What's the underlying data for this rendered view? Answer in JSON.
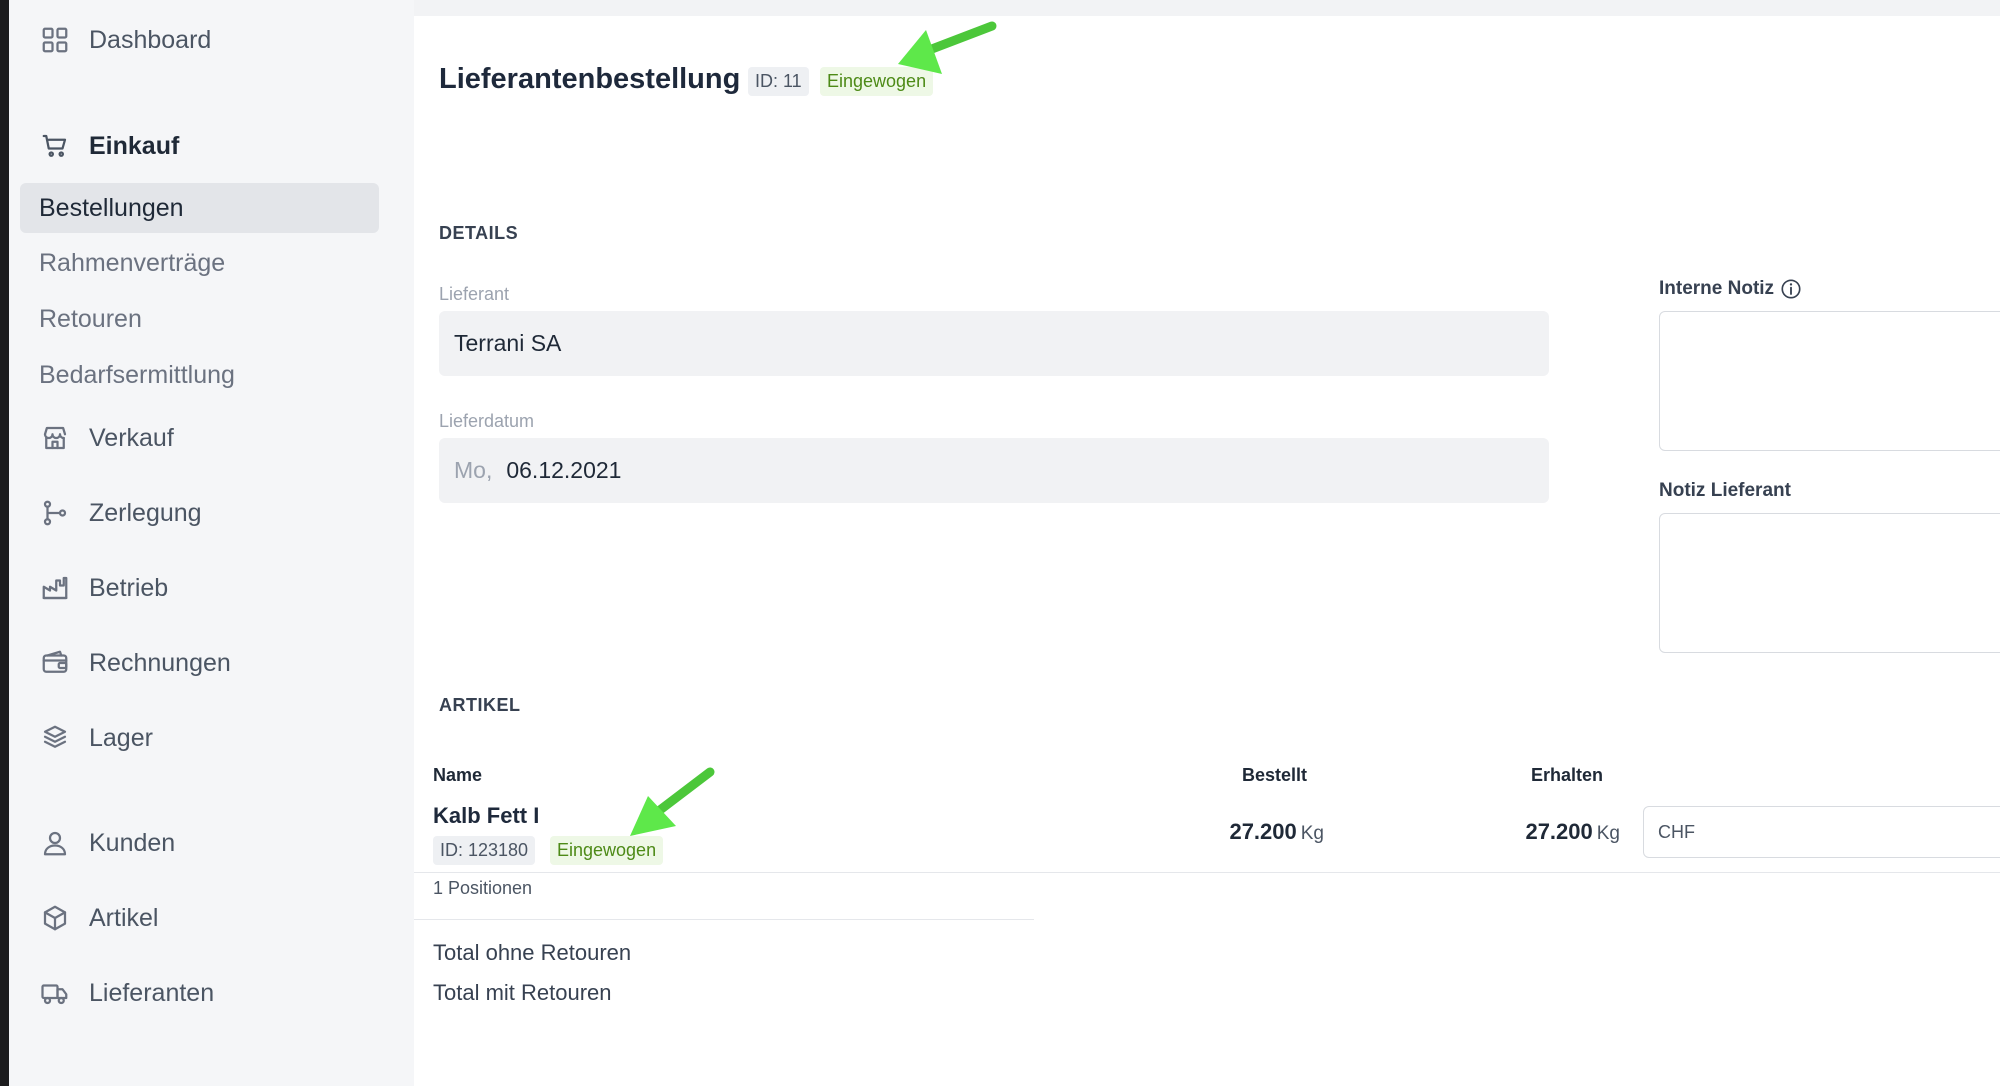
{
  "sidebar": {
    "dashboard": {
      "label": "Dashboard",
      "icon": "grid-icon"
    },
    "einkauf": {
      "label": "Einkauf",
      "icon": "cart-icon",
      "items": [
        {
          "label": "Bestellungen",
          "active": true
        },
        {
          "label": "Rahmenverträge",
          "active": false
        },
        {
          "label": "Retouren",
          "active": false
        },
        {
          "label": "Bedarfsermittlung",
          "active": false
        }
      ]
    },
    "items": [
      {
        "label": "Verkauf",
        "icon": "store-icon"
      },
      {
        "label": "Zerlegung",
        "icon": "branch-icon"
      },
      {
        "label": "Betrieb",
        "icon": "factory-icon"
      },
      {
        "label": "Rechnungen",
        "icon": "wallet-icon"
      },
      {
        "label": "Lager",
        "icon": "layers-icon"
      }
    ],
    "items2": [
      {
        "label": "Kunden",
        "icon": "user-icon"
      },
      {
        "label": "Artikel",
        "icon": "box-icon"
      },
      {
        "label": "Lieferanten",
        "icon": "truck-icon"
      }
    ]
  },
  "header": {
    "title": "Lieferantenbestellung",
    "id_badge": "ID: 11",
    "status": "Eingewogen"
  },
  "details": {
    "section_label": "DETAILS",
    "supplier_label": "Lieferant",
    "supplier_value": "Terrani SA",
    "date_label": "Lieferdatum",
    "date_weekday": "Mo,",
    "date_value": "06.12.2021",
    "internal_note_label": "Interne Notiz",
    "supplier_note_label": "Notiz Lieferant"
  },
  "articles": {
    "section_label": "ARTIKEL",
    "columns": {
      "name": "Name",
      "ordered": "Bestellt",
      "received": "Erhalten"
    },
    "rows": [
      {
        "name": "Kalb Fett I",
        "id_badge": "ID: 123180",
        "status": "Eingewogen",
        "ordered_value": "27.200",
        "ordered_unit": "Kg",
        "received_value": "27.200",
        "received_unit": "Kg",
        "price_currency": "CHF"
      }
    ],
    "positions_count": "1 Positionen",
    "total_without_returns": "Total ohne Retouren",
    "total_with_returns": "Total mit Retouren"
  },
  "colors": {
    "status_green_text": "#4d8a17",
    "status_green_bg": "#eef8e6",
    "annotation_arrow": "#5ee84a",
    "sidebar_active_bg": "#e3e5e9"
  }
}
